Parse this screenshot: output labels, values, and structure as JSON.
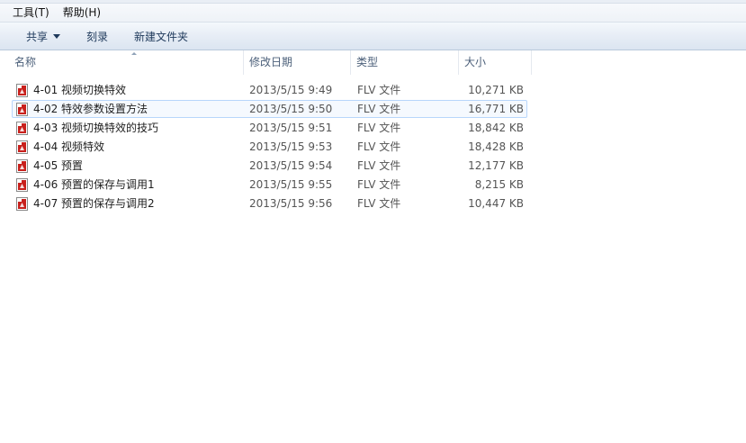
{
  "menu": [
    {
      "label": "工具(T)"
    },
    {
      "label": "帮助(H)"
    }
  ],
  "toolbar": {
    "share_label": "共享",
    "burn_label": "刻录",
    "new_folder_label": "新建文件夹"
  },
  "columns": {
    "name": "名称",
    "date": "修改日期",
    "type": "类型",
    "size": "大小"
  },
  "files": [
    {
      "name": "4-01 视频切换特效",
      "date": "2013/5/15 9:49",
      "type": "FLV 文件",
      "size": "10,271 KB"
    },
    {
      "name": "4-02 特效参数设置方法",
      "date": "2013/5/15 9:50",
      "type": "FLV 文件",
      "size": "16,771 KB"
    },
    {
      "name": "4-03 视频切换特效的技巧",
      "date": "2013/5/15 9:51",
      "type": "FLV 文件",
      "size": "18,842 KB"
    },
    {
      "name": "4-04 视频特效",
      "date": "2013/5/15 9:53",
      "type": "FLV 文件",
      "size": "18,428 KB"
    },
    {
      "name": "4-05 预置",
      "date": "2013/5/15 9:54",
      "type": "FLV 文件",
      "size": "12,177 KB"
    },
    {
      "name": "4-06 预置的保存与调用1",
      "date": "2013/5/15 9:55",
      "type": "FLV 文件",
      "size": "8,215 KB"
    },
    {
      "name": "4-07 预置的保存与调用2",
      "date": "2013/5/15 9:56",
      "type": "FLV 文件",
      "size": "10,447 KB"
    }
  ],
  "hover_row_index": 1,
  "icon": "flv-file-icon",
  "colors": {
    "icon_red": "#c8201c",
    "hover_border": "#b8d6fb",
    "toolbar_text": "#1e395b"
  }
}
